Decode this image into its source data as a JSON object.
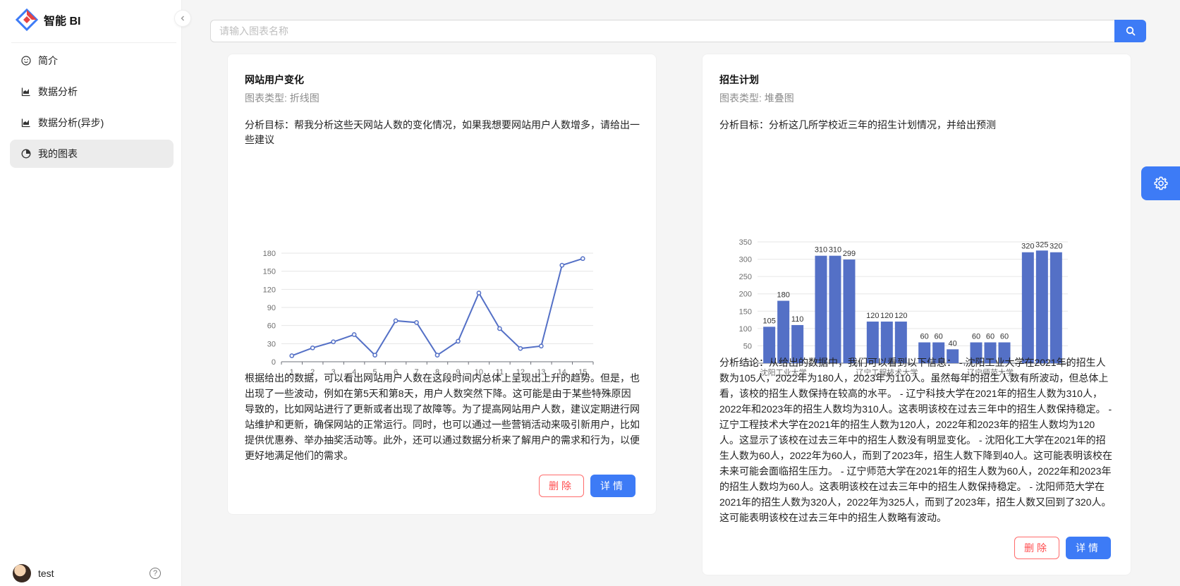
{
  "app": {
    "title": "智能 BI"
  },
  "sidebar": {
    "items": [
      {
        "label": "简介",
        "icon": "smile-icon"
      },
      {
        "label": "数据分析",
        "icon": "line-chart-icon"
      },
      {
        "label": "数据分析(异步)",
        "icon": "line-chart-icon"
      },
      {
        "label": "我的图表",
        "icon": "pie-chart-icon",
        "active": true
      }
    ],
    "user": {
      "name": "test"
    }
  },
  "search": {
    "placeholder": "请输入图表名称",
    "value": ""
  },
  "cards": [
    {
      "title": "网站用户变化",
      "type": "图表类型: 折线图",
      "goal": "分析目标：帮我分析这些天网站人数的变化情况，如果我想要网站用户人数增多，请给出一些建议",
      "conclusion": "根据给出的数据，可以看出网站用户人数在这段时间内总体上呈现出上升的趋势。但是，也出现了一些波动，例如在第5天和第8天，用户人数突然下降。这可能是由于某些特殊原因导致的，比如网站进行了更新或者出现了故障等。为了提高网站用户人数，建议定期进行网站维护和更新，确保网站的正常运行。同时，也可以通过一些营销活动来吸引新用户，比如提供优惠券、举办抽奖活动等。此外，还可以通过数据分析来了解用户的需求和行为，以便更好地满足他们的需求。",
      "delete_label": "删除",
      "detail_label": "详情"
    },
    {
      "title": "招生计划",
      "type": "图表类型: 堆叠图",
      "goal": "分析目标：分析这几所学校近三年的招生计划情况，并给出预测",
      "conclusion": "分析结论：从给出的数据中，我们可以看到以下信息： - 沈阳工业大学在2021年的招生人数为105人，2022年为180人，2023年为110人。虽然每年的招生人数有所波动，但总体上看，该校的招生人数保持在较高的水平。 - 辽宁科技大学在2021年的招生人数为310人，2022年和2023年的招生人数均为310人。这表明该校在过去三年中的招生人数保持稳定。 - 辽宁工程技术大学在2021年的招生人数为120人，2022年和2023年的招生人数均为120人。这显示了该校在过去三年中的招生人数没有明显变化。 - 沈阳化工大学在2021年的招生人数为60人，2022年为60人，而到了2023年，招生人数下降到40人。这可能表明该校在未来可能会面临招生压力。 - 辽宁师范大学在2021年的招生人数为60人，2022年和2023年的招生人数均为60人。这表明该校在过去三年中的招生人数保持稳定。 - 沈阳师范大学在2021年的招生人数为320人，2022年为325人，而到了2023年，招生人数又回到了320人。这可能表明该校在过去三年中的招生人数略有波动。",
      "delete_label": "删除",
      "detail_label": "详情"
    }
  ],
  "colors": {
    "accent": "#3d7bf6",
    "series": "#5470c6",
    "danger": "#ff4d4f"
  },
  "chart_data": [
    {
      "type": "line",
      "x": [
        1,
        2,
        3,
        4,
        5,
        6,
        7,
        8,
        9,
        10,
        11,
        12,
        13,
        14,
        15
      ],
      "values": [
        10,
        23,
        33,
        45,
        11,
        68,
        65,
        11,
        34,
        114,
        55,
        22,
        26,
        160,
        171
      ],
      "ylim": [
        0,
        180
      ],
      "yticks": [
        0,
        30,
        60,
        90,
        120,
        150,
        180
      ],
      "title": "",
      "xlabel": "",
      "ylabel": ""
    },
    {
      "type": "bar",
      "categories": [
        "沈阳工业大学",
        "辽宁科技大学",
        "辽宁工程技术大学",
        "沈阳化工大学",
        "辽宁师范大学",
        "沈阳师范大学"
      ],
      "shown_category_labels": [
        "沈阳工业大学",
        "辽宁工程技术大学",
        "辽宁师范大学"
      ],
      "series": [
        {
          "values": [
            105,
            310,
            120,
            60,
            60,
            320
          ]
        },
        {
          "values": [
            180,
            310,
            120,
            60,
            60,
            325
          ]
        },
        {
          "values": [
            110,
            299,
            120,
            40,
            60,
            320
          ]
        }
      ],
      "ylim": [
        0,
        350
      ],
      "yticks": [
        0,
        50,
        100,
        150,
        200,
        250,
        300,
        350
      ],
      "title": "",
      "xlabel": "",
      "ylabel": ""
    }
  ]
}
